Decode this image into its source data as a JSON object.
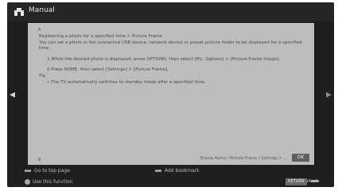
{
  "topbar": {
    "title": "Manual",
    "home_icon": "home-icon"
  },
  "side": {
    "left_arrow": "◀",
    "right_arrow": "▶"
  },
  "panel": {
    "scroll_up": "∧",
    "scroll_down": "∨",
    "heading": "Registering a photo for a specified time > Picture Frame",
    "intro": "You can set a photo in the connected USB device, network device or preset picture folder to be displayed for a specified time.",
    "steps": [
      "1  While the desired photo is displayed, press OPTIONS, then select [Pic. Options] > [Picture Frame Image].",
      "2  Press HOME, then select [Settings] > [Picture Frame]."
    ],
    "tip_label": "Tip",
    "tips": [
      "•  The TV automatically switches to standby mode after a specified time."
    ],
    "footer_text": "Bravia Home / Picture Frame / Settings > ...",
    "ok_label": "OK"
  },
  "hints": {
    "left": "Go to top page",
    "middle": "Add bookmark"
  },
  "bottom": {
    "left": "Use this function",
    "right_badge": "RETURN",
    "right_text": "Back"
  }
}
